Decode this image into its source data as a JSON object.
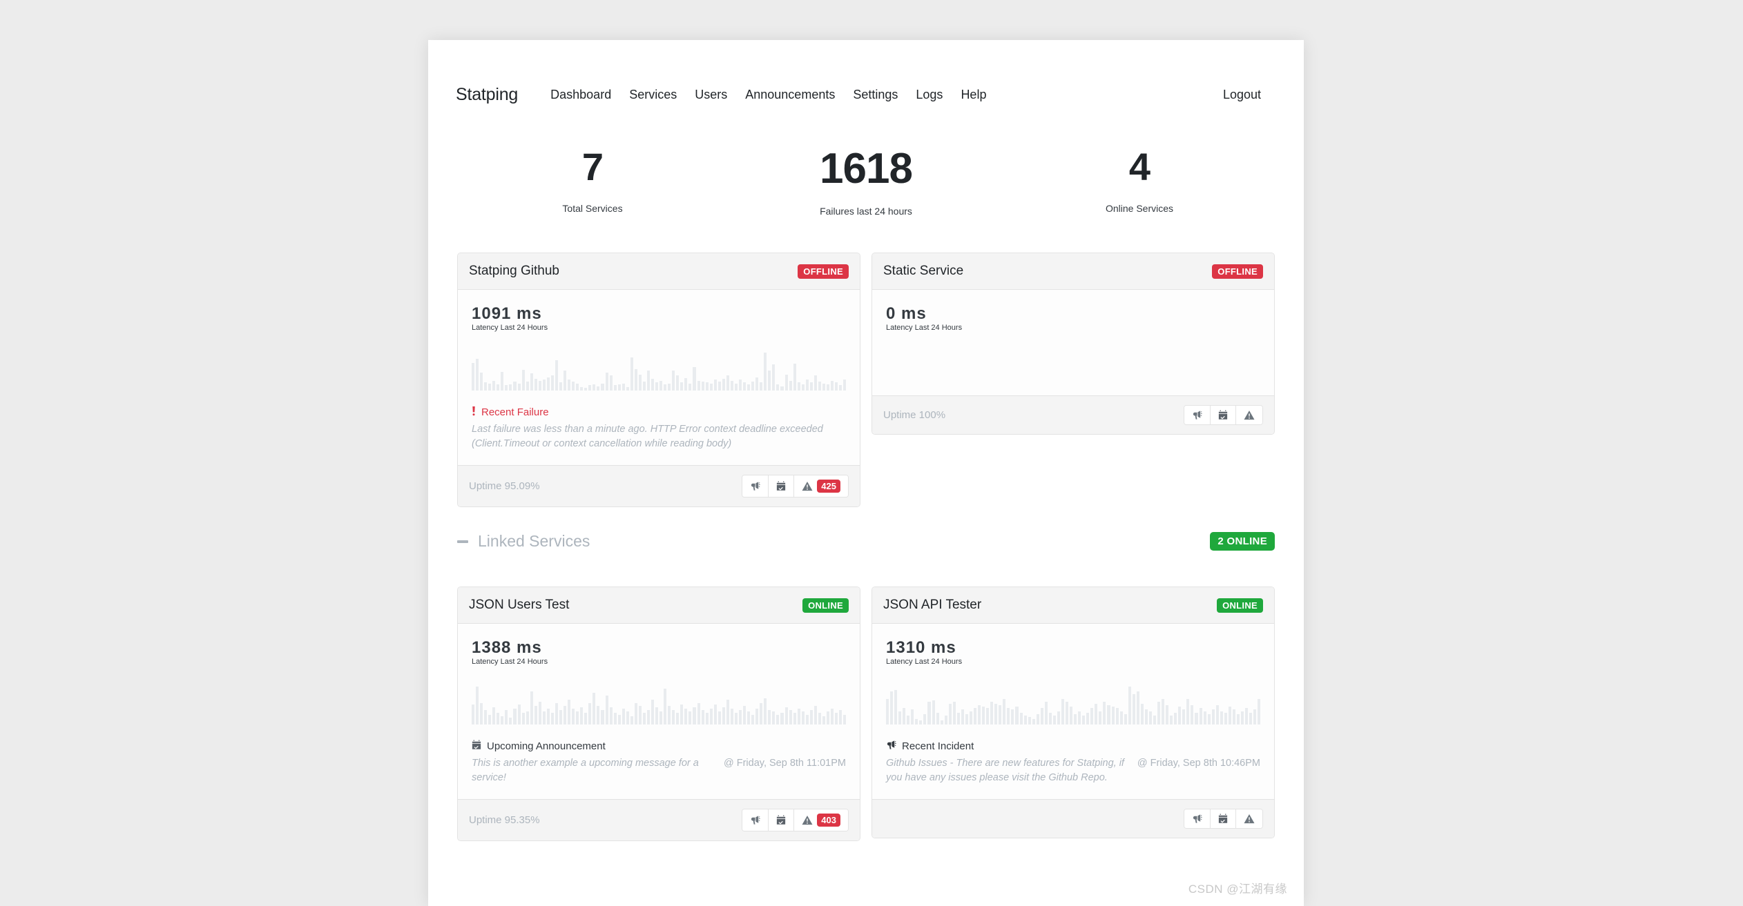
{
  "nav": {
    "brand": "Statping",
    "links": [
      "Dashboard",
      "Services",
      "Users",
      "Announcements",
      "Settings",
      "Logs",
      "Help"
    ],
    "logout": "Logout"
  },
  "stats": [
    {
      "value": "7",
      "label": "Total Services"
    },
    {
      "value": "1618",
      "label": "Failures last 24 hours"
    },
    {
      "value": "4",
      "label": "Online Services"
    }
  ],
  "colors": {
    "offline": "#dc3545",
    "online": "#1fa83c",
    "page_bg": "#ececec",
    "card_header_bg": "#f4f4f4"
  },
  "services": [
    {
      "title": "Statping Github",
      "status": "OFFLINE",
      "status_type": "offline",
      "latency": "1091 ms",
      "latency_label": "Latency Last 24 Hours",
      "message_icon": "exclamation-icon",
      "message_title": "Recent Failure",
      "message_type": "failure",
      "message_text": "Last failure was less than a minute ago. HTTP Error context deadline exceeded (Client.Timeout or context cancellation while reading body)",
      "message_date": "",
      "uptime": "Uptime 95.09%",
      "failure_count": "425",
      "has_count": true,
      "spark": [
        62,
        70,
        40,
        18,
        16,
        22,
        14,
        42,
        12,
        14,
        20,
        16,
        46,
        20,
        38,
        26,
        22,
        24,
        30,
        34,
        68,
        18,
        44,
        24,
        20,
        16,
        8,
        6,
        12,
        14,
        10,
        16,
        40,
        34,
        12,
        14,
        16,
        8,
        74,
        48,
        36,
        20,
        44,
        26,
        18,
        22,
        14,
        16,
        44,
        34,
        18,
        28,
        16,
        52,
        22,
        20,
        18,
        16,
        24,
        20,
        26,
        34,
        22,
        16,
        24,
        18,
        14,
        20,
        30,
        18,
        84,
        44,
        58,
        14,
        10,
        36,
        22,
        60,
        18,
        14,
        24,
        18,
        34,
        20,
        16,
        14,
        22,
        18,
        12,
        24
      ]
    },
    {
      "title": "Static Service",
      "status": "OFFLINE",
      "status_type": "offline",
      "latency": "0 ms",
      "latency_label": "Latency Last 24 Hours",
      "message_icon": "",
      "message_title": "",
      "message_type": "",
      "message_text": "",
      "message_date": "",
      "uptime": "Uptime 100%",
      "failure_count": "",
      "has_count": false,
      "spark": []
    }
  ],
  "group": {
    "collapse_icon": "minus-icon",
    "title": "Linked Services",
    "badge": "2 ONLINE",
    "services": [
      {
        "title": "JSON Users Test",
        "status": "ONLINE",
        "status_type": "online",
        "latency": "1388 ms",
        "latency_label": "Latency Last 24 Hours",
        "message_icon": "calendar-icon",
        "message_title": "Upcoming Announcement",
        "message_type": "normal",
        "message_text": "This is another example a upcoming message for a service!",
        "message_date": "@ Friday, Sep 8th 11:01PM",
        "uptime": "Uptime 95.35%",
        "failure_count": "403",
        "has_count": true,
        "spark": [
          28,
          52,
          30,
          20,
          14,
          24,
          16,
          12,
          20,
          10,
          22,
          28,
          16,
          18,
          46,
          26,
          32,
          18,
          22,
          16,
          30,
          20,
          26,
          34,
          22,
          18,
          24,
          16,
          30,
          44,
          26,
          20,
          40,
          24,
          16,
          14,
          22,
          18,
          12,
          30,
          26,
          16,
          20,
          34,
          24,
          18,
          50,
          26,
          20,
          16,
          28,
          22,
          18,
          24,
          30,
          20,
          16,
          22,
          28,
          18,
          24,
          34,
          22,
          16,
          20,
          26,
          18,
          14,
          22,
          30,
          36,
          20,
          18,
          14,
          16,
          24,
          20,
          16,
          22,
          18,
          14,
          20,
          26,
          16,
          12,
          18,
          22,
          16,
          20,
          14
        ]
      },
      {
        "title": "JSON API Tester",
        "status": "ONLINE",
        "status_type": "online",
        "latency": "1310 ms",
        "latency_label": "Latency Last 24 Hours",
        "message_icon": "megaphone-icon",
        "message_title": "Recent Incident",
        "message_type": "normal",
        "message_text": "Github Issues - There are new features for Statping, if you have any issues please visit the Github Repo.",
        "message_date": "@ Friday, Sep 8th 10:46PM",
        "uptime": "",
        "failure_count": "",
        "has_count": false,
        "spark": [
          34,
          44,
          46,
          18,
          22,
          12,
          20,
          8,
          6,
          14,
          30,
          32,
          16,
          6,
          12,
          28,
          30,
          16,
          20,
          14,
          18,
          22,
          26,
          24,
          22,
          30,
          28,
          26,
          34,
          22,
          20,
          24,
          16,
          12,
          10,
          8,
          14,
          22,
          30,
          16,
          12,
          18,
          34,
          30,
          24,
          14,
          18,
          12,
          16,
          22,
          28,
          18,
          30,
          26,
          24,
          22,
          18,
          14,
          50,
          40,
          44,
          28,
          20,
          18,
          12,
          30,
          34,
          26,
          12,
          16,
          24,
          20,
          34,
          26,
          16,
          22,
          18,
          14,
          20,
          26,
          18,
          16,
          24,
          20,
          14,
          18,
          22,
          16,
          20,
          34
        ]
      }
    ]
  },
  "watermark": "CSDN @江湖有缘"
}
